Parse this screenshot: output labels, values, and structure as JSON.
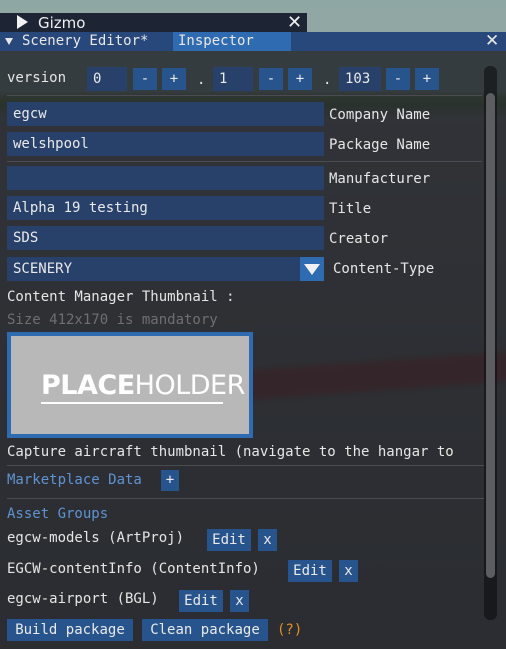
{
  "gizmo": {
    "title": "Gizmo",
    "close": "✕"
  },
  "window": {
    "tabs": [
      {
        "label": "Scenery Editor*"
      },
      {
        "label": "Inspector"
      }
    ],
    "close": "✕"
  },
  "version": {
    "label": "version",
    "major": "0",
    "minor": "1",
    "patch": "103",
    "minus": "-",
    "plus": "+",
    "dot": "."
  },
  "fields": {
    "company": {
      "value": "egcw",
      "label": "Company Name"
    },
    "package": {
      "value": "welshpool",
      "label": "Package Name"
    },
    "manufacturer": {
      "value": "",
      "label": "Manufacturer"
    },
    "title": {
      "value": "Alpha 19 testing",
      "label": "Title"
    },
    "creator": {
      "value": "SDS",
      "label": "Creator"
    },
    "content_type": {
      "value": "SCENERY",
      "label": "Content-Type"
    }
  },
  "thumbnail": {
    "heading": "Content Manager Thumbnail :",
    "hint": "Size 412x170 is mandatory",
    "placeholder_a": "PLACE",
    "placeholder_b": "HOLDER"
  },
  "capture_text": "Capture aircraft thumbnail (navigate to the hangar to",
  "marketplace": {
    "label": "Marketplace Data",
    "add": "+"
  },
  "asset_groups": {
    "heading": "Asset Groups",
    "items": [
      {
        "name": "egcw-models (ArtProj)",
        "edit": "Edit",
        "remove": "x"
      },
      {
        "name": "EGCW-contentInfo (ContentInfo)",
        "edit": "Edit",
        "remove": "x"
      },
      {
        "name": "egcw-airport (BGL)",
        "edit": "Edit",
        "remove": "x"
      }
    ]
  },
  "actions": {
    "build": "Build package",
    "clean": "Clean package",
    "help": "(?)"
  },
  "colors": {
    "accent": "#2f6bb0",
    "field": "#27416b",
    "button": "#28548e",
    "header_text": "#5f93d1",
    "help": "#e6921f"
  }
}
